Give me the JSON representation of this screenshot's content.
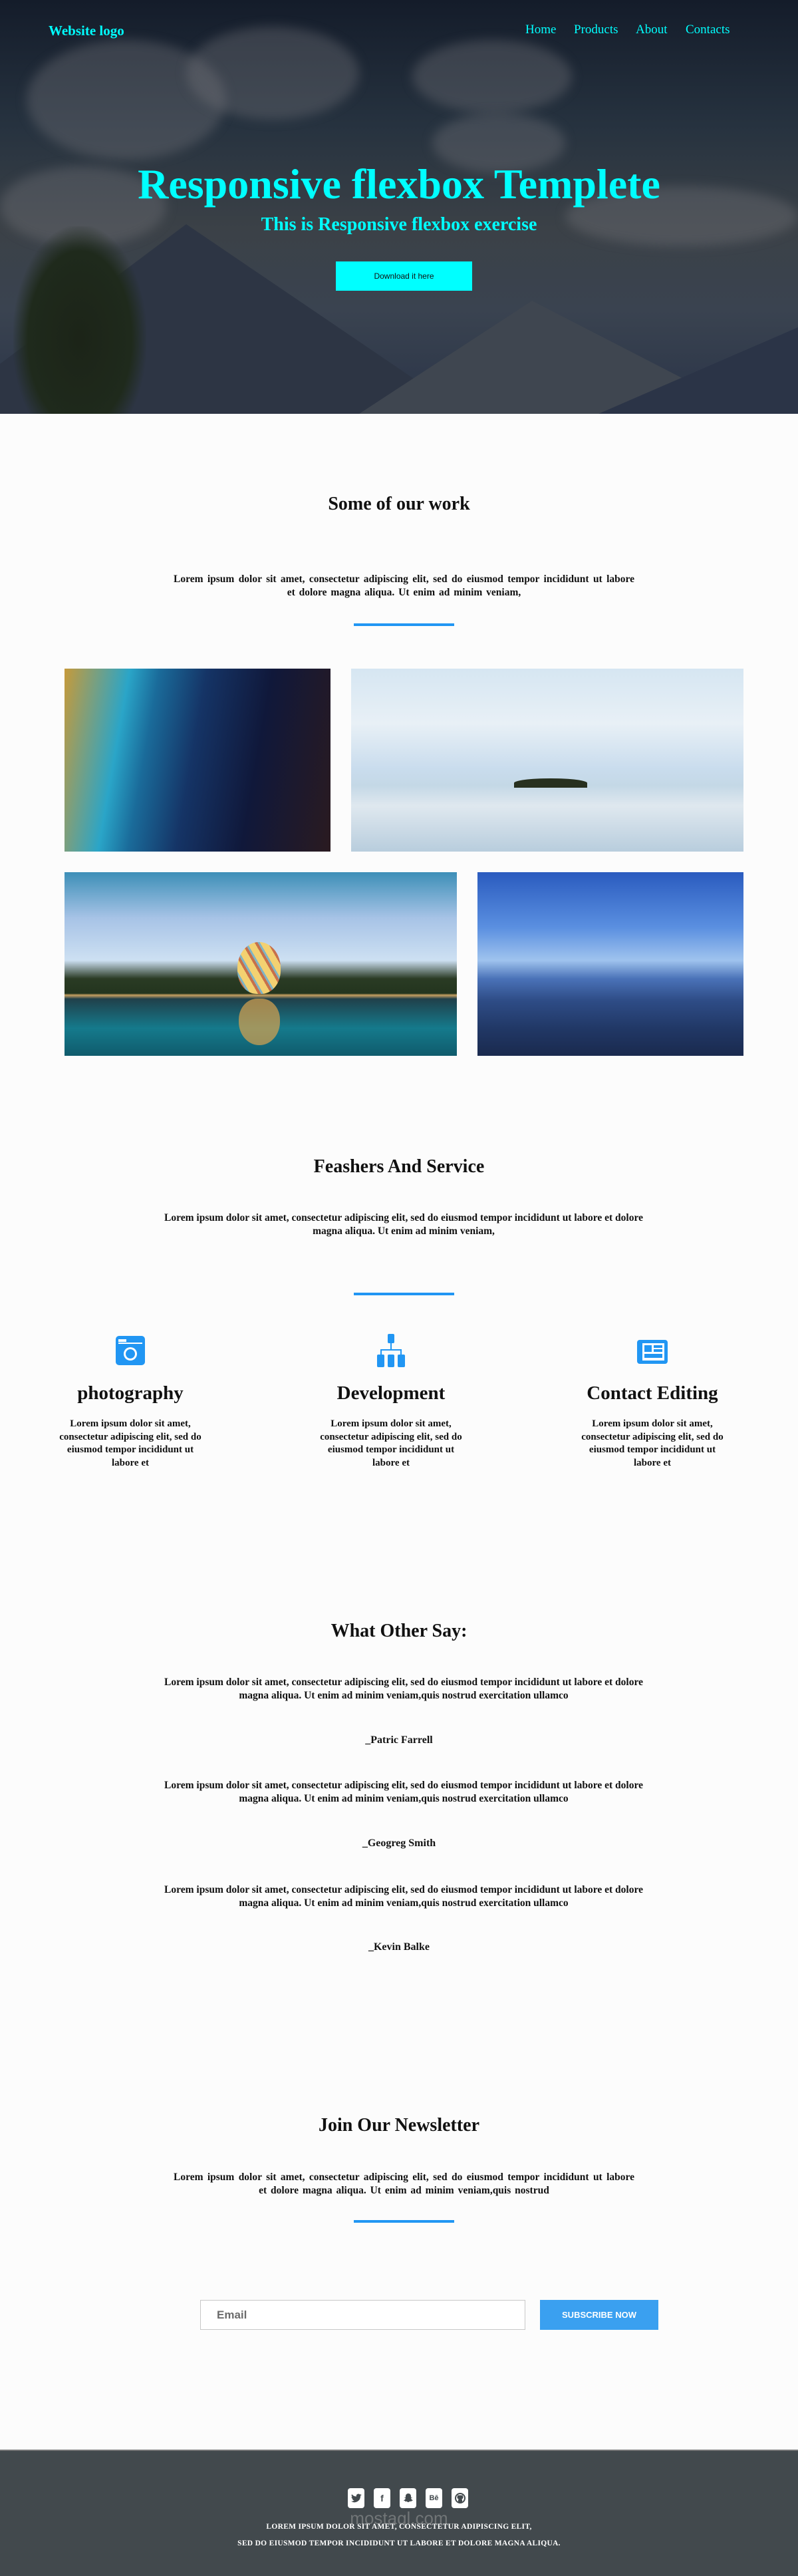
{
  "header": {
    "logo": "Website logo",
    "nav": [
      "Home",
      "Products",
      "About",
      "Contacts"
    ],
    "title": "Responsive flexbox Templete",
    "subtitle": "This is Responsive flexbox exercise",
    "download_label": "Download it here"
  },
  "colors": {
    "accent": "#00ffff",
    "blue": "#2196f3",
    "subscribe": "#3aa0f0",
    "footer": "#42494d"
  },
  "work": {
    "title": "Some of our work",
    "text": "Lorem ipsum dolor sit amet, consectetur adipiscing elit, sed do eiusmod tempor incididunt ut labore et dolore magna aliqua. Ut enim ad minim veniam,",
    "images": [
      "aerial coastline",
      "sea with island",
      "hot air balloon over lake",
      "blue mountains"
    ]
  },
  "services": {
    "title": "Feashers And Service",
    "text": "Lorem ipsum dolor sit amet, consectetur adipiscing elit, sed do eiusmod tempor incididunt ut labore et dolore magna aliqua. Ut enim ad minim veniam,",
    "items": [
      {
        "icon": "camera-icon",
        "title": "photography",
        "text": "Lorem ipsum dolor sit amet, consectetur adipiscing elit, sed do eiusmod tempor incididunt ut labore et"
      },
      {
        "icon": "sitemap-icon",
        "title": "Development",
        "text": "Lorem ipsum dolor sit amet, consectetur adipiscing elit, sed do eiusmod tempor incididunt ut labore et"
      },
      {
        "icon": "newspaper-icon",
        "title": "Contact Editing",
        "text": "Lorem ipsum dolor sit amet, consectetur adipiscing elit, sed do eiusmod tempor incididunt ut labore et"
      }
    ]
  },
  "testimonials": {
    "title": "What Other Say:",
    "items": [
      {
        "text": "Lorem ipsum dolor sit amet, consectetur adipiscing elit, sed do eiusmod tempor incididunt ut labore et dolore magna aliqua. Ut enim ad minim veniam,quis nostrud exercitation ullamco",
        "name": "_Patric Farrell"
      },
      {
        "text": "Lorem ipsum dolor sit amet, consectetur adipiscing elit, sed do eiusmod tempor incididunt ut labore et dolore magna aliqua. Ut enim ad minim veniam,quis nostrud exercitation ullamco",
        "name": "_Geogreg Smith"
      },
      {
        "text": "Lorem ipsum dolor sit amet, consectetur adipiscing elit, sed do eiusmod tempor incididunt ut labore et dolore magna aliqua. Ut enim ad minim veniam,quis nostrud exercitation ullamco",
        "name": "_Kevin Balke"
      }
    ]
  },
  "newsletter": {
    "title": "Join Our Newsletter",
    "text": "Lorem ipsum dolor sit amet, consectetur adipiscing elit, sed do eiusmod tempor incididunt ut labore et dolore magna aliqua. Ut enim ad minim veniam,quis nostrud",
    "email_placeholder": "Email",
    "subscribe_label": "SUBSCRIBE NOW"
  },
  "footer": {
    "social": [
      "twitter-icon",
      "facebook-icon",
      "snapchat-icon",
      "behance-icon",
      "github-icon"
    ],
    "behance_glyph": "Bē",
    "line1": "LOREM IPSUM DOLOR SIT AMET, CONSECTETUR ADIPISCING ELIT,",
    "line2": "SED DO EIUSMOD TEMPOR INCIDIDUNT UT LABORE ET DOLORE MAGNA ALIQUA.",
    "watermark": "mostaql.com"
  }
}
